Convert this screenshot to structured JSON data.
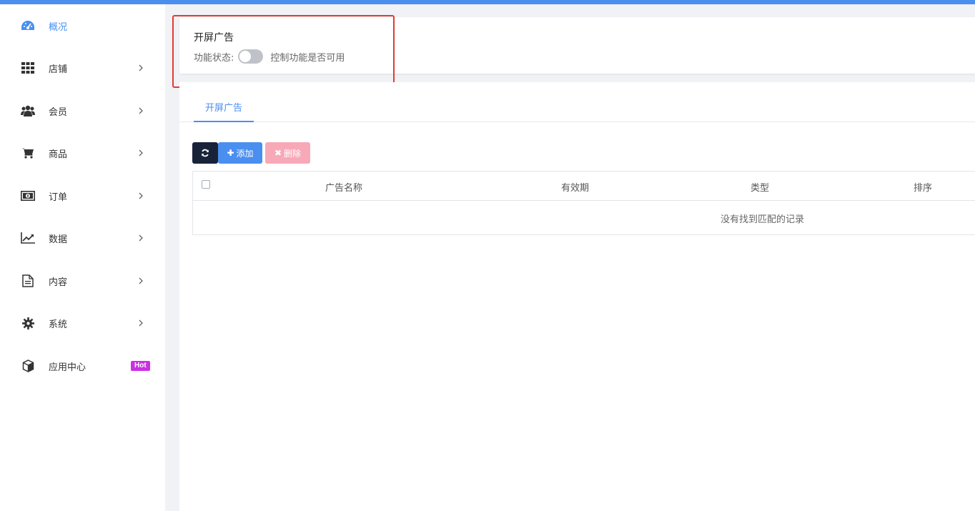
{
  "colors": {
    "accent": "#4a8ff0",
    "dark_button": "#18233a",
    "delete_button": "#f7a9b8",
    "hot_badge": "#cc2fe5",
    "highlight": "#e53a2f"
  },
  "sidebar": {
    "items": [
      {
        "label": "概况",
        "icon": "dashboard-icon",
        "active": true
      },
      {
        "label": "店铺",
        "icon": "grid-icon"
      },
      {
        "label": "会员",
        "icon": "users-icon"
      },
      {
        "label": "商品",
        "icon": "cart-icon"
      },
      {
        "label": "订单",
        "icon": "money-icon"
      },
      {
        "label": "数据",
        "icon": "line-chart-icon"
      },
      {
        "label": "内容",
        "icon": "document-icon"
      },
      {
        "label": "系统",
        "icon": "gear-icon"
      },
      {
        "label": "应用中心",
        "icon": "cube-icon",
        "badge": "Hot"
      }
    ]
  },
  "status_card": {
    "title": "开屏广告",
    "status_label": "功能状态:",
    "hint": "控制功能是否可用",
    "enabled": false
  },
  "tabs": [
    {
      "label": "开屏广告",
      "active": true
    }
  ],
  "toolbar": {
    "add_label": "添加",
    "delete_label": "删除"
  },
  "table": {
    "columns": [
      "广告名称",
      "有效期",
      "类型",
      "排序"
    ],
    "empty_text": "没有找到匹配的记录"
  }
}
